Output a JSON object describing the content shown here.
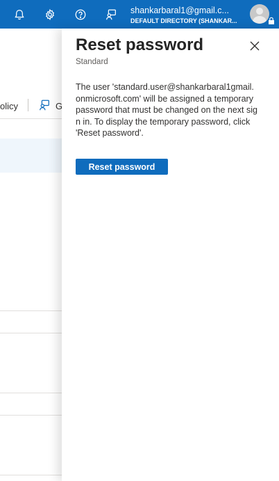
{
  "topbar": {
    "account_email": "shankarbaral1@gmail.c...",
    "directory": "DEFAULT DIRECTORY (SHANKAR..."
  },
  "background": {
    "toolbar_policy_fragment": "olicy",
    "toolbar_next_fragment": "G"
  },
  "panel": {
    "title": "Reset password",
    "subtitle": "Standard",
    "description": "The user 'standard.user@shankarbaral1gmail.onmicrosoft.com' will be assigned a temporary password that must be changed on the next sign in. To display the temporary password, click 'Reset password'.",
    "reset_button_label": "Reset password"
  },
  "colors": {
    "topbar": "#0f6cbd",
    "primary_button": "#0f6cbd"
  }
}
